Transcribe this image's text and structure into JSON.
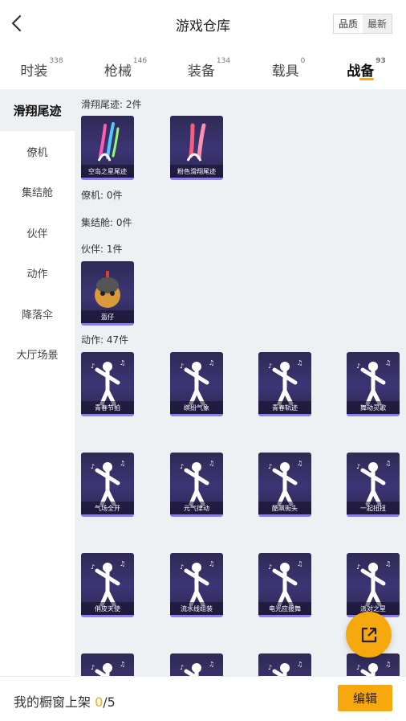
{
  "header": {
    "title": "游戏仓库",
    "sort_quality": "品质",
    "sort_latest": "最新"
  },
  "tabs": [
    {
      "label": "时装",
      "count": "338"
    },
    {
      "label": "枪械",
      "count": "146"
    },
    {
      "label": "装备",
      "count": "134"
    },
    {
      "label": "载具",
      "count": "0"
    },
    {
      "label": "战备",
      "count": "93"
    }
  ],
  "sidebar": [
    {
      "label": "滑翔尾迹"
    },
    {
      "label": "僚机"
    },
    {
      "label": "集结舱"
    },
    {
      "label": "伙伴"
    },
    {
      "label": "动作"
    },
    {
      "label": "降落伞"
    },
    {
      "label": "大厅场景"
    }
  ],
  "sections": {
    "glide": "滑翔尾迹: 2件",
    "wingman": "僚机: 0件",
    "pod": "集结舱: 0件",
    "partner": "伙伴: 1件",
    "emote": "动作: 47件"
  },
  "items": {
    "glide": [
      "空岛之星尾迹",
      "粉色滑翔尾迹"
    ],
    "partner": [
      "盔仔"
    ],
    "emote": [
      "青春节拍",
      "缤纷气象",
      "青春轨迹",
      "舞动灵歌",
      "气场全开",
      "元气律动",
      "酷飒街头",
      "一起扭扭",
      "俏皮天使",
      "流水线组装",
      "电光应援舞",
      "派对之星",
      "",
      "",
      "",
      ""
    ]
  },
  "footer": {
    "label": "我的橱窗上架 ",
    "current": "0",
    "total": "/5",
    "edit": "编辑"
  },
  "colors": {
    "accent": "#f7a80c",
    "card_top": "#2f2a55",
    "card_border": "#8f7df0"
  }
}
